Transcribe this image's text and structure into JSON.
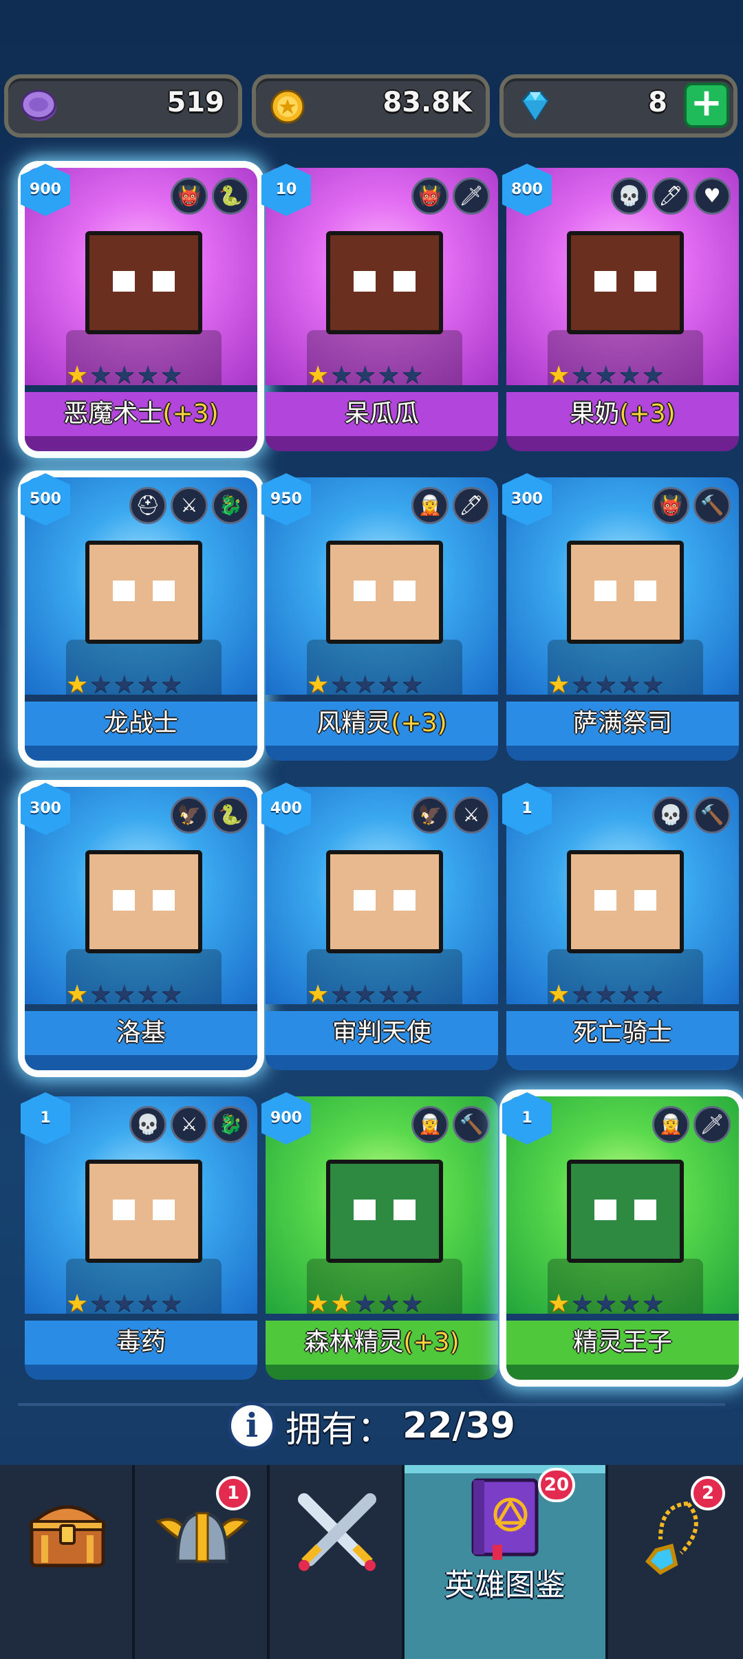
{
  "currencies": {
    "purple": {
      "amount": "519",
      "icon": "purple-token-icon",
      "color": "#9b6bd6"
    },
    "gold": {
      "amount": "83.8K",
      "icon": "gold-coin-icon",
      "color": "#f5b820"
    },
    "gem": {
      "amount": "8",
      "icon": "blue-gem-icon",
      "color": "#3cc6f5",
      "plus_label": "+"
    }
  },
  "heroes": [
    {
      "name": "恶魔术士",
      "bonus": "(+3)",
      "level": "900",
      "stars": 1,
      "rarity": "purple",
      "tags": [
        "👹",
        "🐍"
      ]
    },
    {
      "name": "呆瓜瓜",
      "bonus": "",
      "level": "10",
      "stars": 1,
      "rarity": "purple",
      "tags": [
        "👹",
        "🗡"
      ]
    },
    {
      "name": "果奶",
      "bonus": "(+3)",
      "level": "800",
      "stars": 1,
      "rarity": "purple",
      "tags": [
        "💀",
        "🖊",
        "♥"
      ]
    },
    {
      "name": "龙战士",
      "bonus": "",
      "level": "500",
      "stars": 1,
      "rarity": "blue",
      "tags": [
        "⛑",
        "⚔",
        "🐉"
      ]
    },
    {
      "name": "风精灵",
      "bonus": "(+3)",
      "level": "950",
      "stars": 1,
      "rarity": "blue",
      "tags": [
        "🧝",
        "🖊"
      ]
    },
    {
      "name": "萨满祭司",
      "bonus": "",
      "level": "300",
      "stars": 1,
      "rarity": "blue",
      "tags": [
        "👹",
        "🔨"
      ]
    },
    {
      "name": "洛基",
      "bonus": "",
      "level": "300",
      "stars": 1,
      "rarity": "blue",
      "tags": [
        "🦅",
        "🐍"
      ]
    },
    {
      "name": "审判天使",
      "bonus": "",
      "level": "400",
      "stars": 1,
      "rarity": "blue",
      "tags": [
        "🦅",
        "⚔"
      ]
    },
    {
      "name": "死亡骑士",
      "bonus": "",
      "level": "1",
      "stars": 1,
      "rarity": "blue",
      "tags": [
        "💀",
        "🔨"
      ]
    },
    {
      "name": "毒药",
      "bonus": "",
      "level": "1",
      "stars": 1,
      "rarity": "blue",
      "tags": [
        "💀",
        "⚔",
        "🐉"
      ]
    },
    {
      "name": "森林精灵",
      "bonus": "(+3)",
      "level": "900",
      "stars": 2,
      "rarity": "green",
      "tags": [
        "🧝",
        "🔨"
      ]
    },
    {
      "name": "精灵王子",
      "bonus": "",
      "level": "1",
      "stars": 1,
      "rarity": "green",
      "tags": [
        "🧝",
        "🗡"
      ]
    }
  ],
  "owned": {
    "label": "拥有：",
    "value": "22/39"
  },
  "nav": {
    "chest": {
      "icon": "treasure-chest-icon"
    },
    "heroes": {
      "icon": "viking-helmet-icon",
      "badge": "1"
    },
    "battle": {
      "icon": "crossed-swords-icon"
    },
    "codex": {
      "icon": "hero-book-icon",
      "label": "英雄图鉴",
      "badge": "20"
    },
    "amulet": {
      "icon": "amulet-icon",
      "badge": "2"
    }
  }
}
